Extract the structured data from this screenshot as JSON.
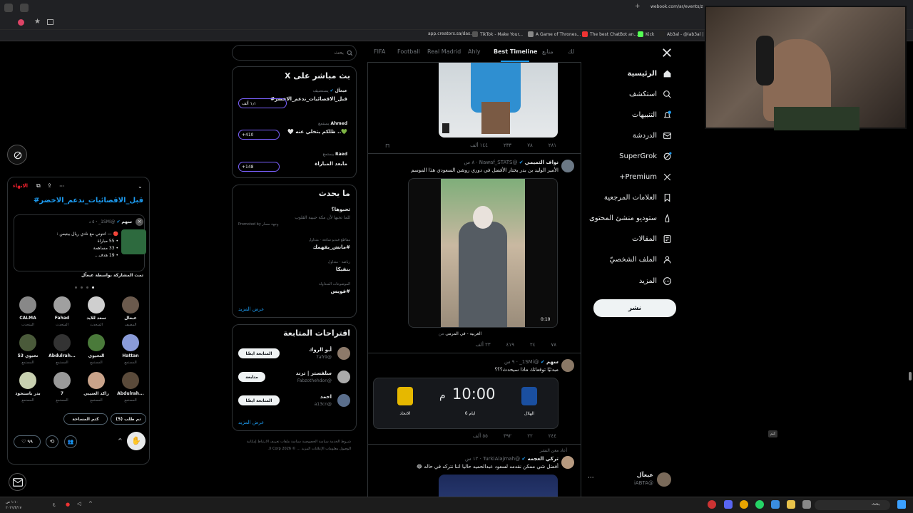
{
  "browser": {
    "url": "webook.com/ar/events/z",
    "bookmarks": [
      "app.creators.sa/das...",
      "TikTok - Make Your...",
      "A Game of Thrones...",
      "The best ChatBot an...",
      "Kick",
      "Ab3al - @iab3al | ..."
    ]
  },
  "nav": {
    "items": [
      {
        "label": "الرئيسية",
        "icon": "home-icon"
      },
      {
        "label": "استكشف",
        "icon": "search-icon"
      },
      {
        "label": "التنبيهات",
        "icon": "bell-icon"
      },
      {
        "label": "الدردشة",
        "icon": "mail-icon"
      },
      {
        "label": "SuperGrok",
        "icon": "grok-icon"
      },
      {
        "label": "Premium+",
        "icon": "x-logo-icon"
      },
      {
        "label": "العلامات المرجعية",
        "icon": "bookmark-icon"
      },
      {
        "label": "ستوديو منشئ المحتوى",
        "icon": "creator-icon"
      },
      {
        "label": "المقالات",
        "icon": "articles-icon"
      },
      {
        "label": "الملف الشخصيّ",
        "icon": "profile-icon"
      },
      {
        "label": "المزيد",
        "icon": "more-icon"
      }
    ],
    "post_button": "نشر",
    "account": {
      "name": "عبعآل",
      "handle": "@iABTA"
    }
  },
  "tabs": [
    "لك",
    "متابع",
    "Best Timeline",
    "Ahly",
    "Real Madrid",
    "Football",
    "FIFA"
  ],
  "tweets": [
    {
      "stats": [
        "٢٨١",
        "٧٨",
        "٢٣٣",
        "١٤٤ ألف"
      ]
    },
    {
      "name": "نواف التميمي",
      "handle": "@Nawaf_STATS",
      "time": "٨ س",
      "text": "الأمير الوليد بن بدر يختار الأفضل في دوري روشن السعودي هذا الموسم",
      "duration": "0:10",
      "source": "العربية - في المرمى",
      "stats": [
        "٧٨",
        "٢٤",
        "٤١٩",
        "٢٣ ألف"
      ]
    },
    {
      "name": "سهم",
      "handle": "@1SMi_",
      "time": "٩ س",
      "text": "مبدئيًا توقعاتك ماذا سيحدث؟؟؟",
      "match": {
        "home": "الهلال",
        "away": "الاتحاد",
        "time": "10:00",
        "ampm": "م",
        "days": "6 ايام"
      },
      "stats": [
        "٢٤٤",
        "٢٢",
        "٣٩٢",
        "٥٥ ألف"
      ]
    },
    {
      "retweet": "أعاد معن النشر",
      "name": "تركي العجمه",
      "handle": "@TurkiAlajmah",
      "time": "١٢ س",
      "text": "أفضل شي ممكن نقدمه لسعود عبدالحميد حاليا اننا نتركه في حاله 😂"
    }
  ],
  "search": {
    "placeholder": "بحث"
  },
  "live": {
    "title": "بث مباشر على X",
    "items": [
      {
        "host": "عبعآل",
        "status": "يستضيف",
        "title": "قبل_الاقصائيات_ندعم_الاخضر#",
        "count": "١٫١ ألف"
      },
      {
        "host": "Ahmed",
        "status": "يستمع",
        "title": "💚.. ظلكم بتخلي عنه 🤍",
        "count": "+410"
      },
      {
        "host": "Raed",
        "status": "يستمع",
        "title": "مابعد المباراة",
        "count": "+148"
      }
    ]
  },
  "trends": {
    "title": "ما يحدث",
    "items": [
      {
        "cat": "",
        "name": "تحبوها؟",
        "desc": "للما تحبها لأن مكة حبيبة القلوب",
        "promo": "Promoted by وجهة مسار"
      },
      {
        "cat": "مقاطع فيديو شائعة · متداول",
        "name": "#مانش_يفهمك"
      },
      {
        "cat": "رياضة · متداول",
        "name": "بنفيكا"
      },
      {
        "cat": "الموضوعات المتداولة",
        "name": "#فويس"
      }
    ],
    "show_more": "عرض المزيد"
  },
  "follow": {
    "title": "اقتراحات المتابعة",
    "items": [
      {
        "name": "أبو الروك",
        "handle": "@7afr9",
        "btn": "المتابعة ايضًا"
      },
      {
        "name": "سلفستر | ترند",
        "handle": "@Fabzothehdon",
        "btn": "متابعة"
      },
      {
        "name": "احمد",
        "handle": "@a13cn",
        "btn": "المتابعة ايضًا"
      }
    ],
    "show_more": "عرض المزيد"
  },
  "footer": [
    "شروط الخدمة",
    "سياسة الخصوصية",
    "سياسة ملفات تعريف الارتباط",
    "إمكانية الوصول",
    "معلومات الإعلانات",
    "المزيد ...",
    "© 2026 X Corp."
  ],
  "space": {
    "leave": "الانهاء",
    "title": "قبل_الاقصائيات_ندعم_الاخضر#",
    "pinned": {
      "name": "سهم",
      "handle": "@1SMi_",
      "time": "٥ د",
      "lines": [
        "🔴 — انتوني مع نادي ريال بيتيس :",
        "• 55 مباراة",
        "• 33 مساهمة",
        "• 19 هدف..."
      ],
      "shared": "تمت المشاركة بواسطة عبعآل"
    },
    "people": [
      {
        "name": "عبعآل",
        "role": "المضيف"
      },
      {
        "name": "سعد للايد",
        "role": "المتحدث"
      },
      {
        "name": "Fahad",
        "role": "المتحدث"
      },
      {
        "name": "CALMA",
        "role": "المتحدث"
      },
      {
        "name": "Hattan",
        "role": "المستمع"
      },
      {
        "name": "التحيوي",
        "role": "المستمع"
      },
      {
        "name": "Abdulrah...",
        "role": "المستمع"
      },
      {
        "name": "53 نخبوي",
        "role": "المستمع"
      },
      {
        "name": "Abdulrah...",
        "role": "المستمع"
      },
      {
        "name": "راكد العنيبي",
        "role": "المستمع"
      },
      {
        "name": "7",
        "role": "المستمع"
      },
      {
        "name": "بدر باستحوذ",
        "role": "المستمع"
      }
    ],
    "requests": "تم طلب (5)",
    "count_btn": "كتم المساحة",
    "likes": "٩٩"
  },
  "overlay": {
    "label": "كتم"
  },
  "taskbar": {
    "search": "بحث",
    "time": "١:١٠ ص",
    "date": "٢٠٢٦/٣/١٧",
    "lang": "ع"
  }
}
